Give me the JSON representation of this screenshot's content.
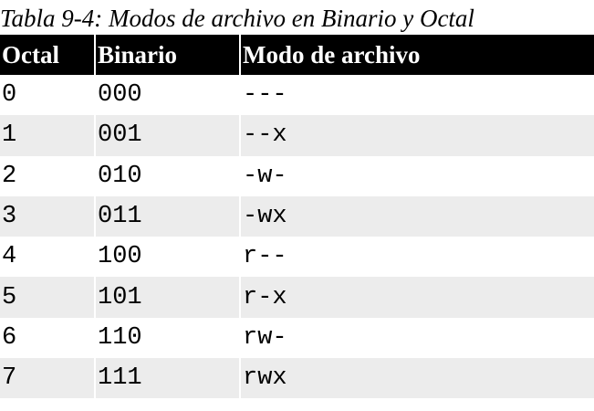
{
  "caption": "Tabla 9-4: Modos de archivo en Binario y Octal",
  "table": {
    "headers": [
      "Octal",
      "Binario",
      "Modo de archivo"
    ],
    "rows": [
      [
        "0",
        "000",
        "---"
      ],
      [
        "1",
        "001",
        "--x"
      ],
      [
        "2",
        "010",
        "-w-"
      ],
      [
        "3",
        "011",
        "-wx"
      ],
      [
        "4",
        "100",
        "r--"
      ],
      [
        "5",
        "101",
        "r-x"
      ],
      [
        "6",
        "110",
        "rw-"
      ],
      [
        "7",
        "111",
        "rwx"
      ]
    ]
  },
  "colors": {
    "header_background": "#000000",
    "header_text": "#ffffff",
    "row_alt_background": "#ececec"
  }
}
